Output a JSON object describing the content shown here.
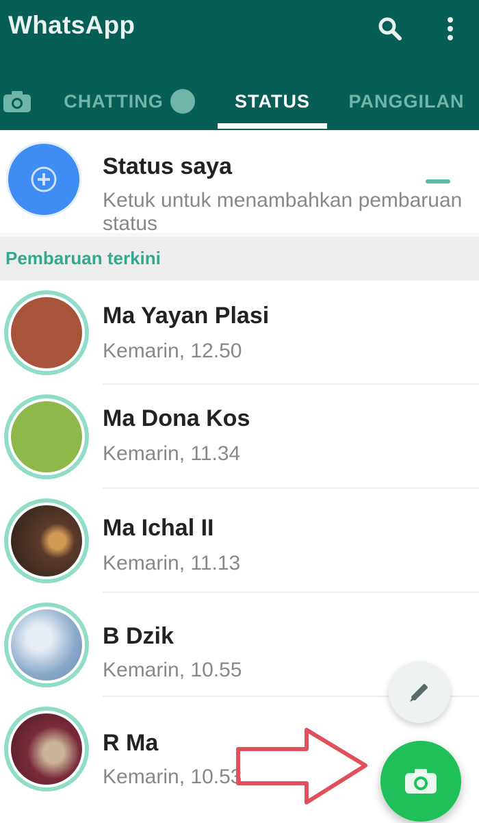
{
  "app": {
    "title": "WhatsApp"
  },
  "header": {
    "icons": [
      "camera-icon",
      "search-icon",
      "more-vert-icon"
    ],
    "tabs": [
      {
        "label": "CHATTING",
        "badge": ""
      },
      {
        "label": "STATUS"
      },
      {
        "label": "PANGGILAN"
      }
    ]
  },
  "my_status": {
    "name": "Status saya",
    "subtitle": "Ketuk untuk menambahkan pembaruan status"
  },
  "section": {
    "label": "Pembaruan terkini"
  },
  "updates": [
    {
      "name": "Ma Yayan Plasi",
      "time": "Kemarin, 12.50"
    },
    {
      "name": "Ma Dona Kos",
      "time": "Kemarin, 11.34"
    },
    {
      "name": "Ma Ichal II",
      "time": "Kemarin, 11.13"
    },
    {
      "name": "B Dzik",
      "time": "Kemarin, 10.55"
    },
    {
      "name": "R Ma",
      "time": "Kemarin, 10.53"
    }
  ],
  "colors": {
    "header": "#075e54",
    "accent": "#25d366",
    "ring": "#8fdcc9"
  },
  "fabs": {
    "pencil": "pencil-icon",
    "camera": "camera-icon"
  }
}
